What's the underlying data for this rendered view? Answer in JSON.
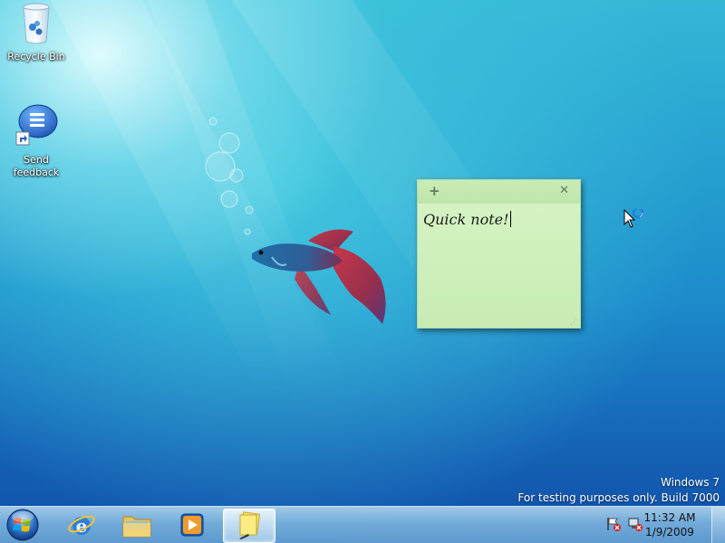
{
  "desktop": {
    "icons": [
      {
        "label": "Recycle Bin"
      },
      {
        "label": "Send feedback"
      }
    ],
    "watermark": {
      "line1": "Windows  7",
      "line2": "For testing purposes only. Build 7000"
    }
  },
  "sticky_note": {
    "text": "Quick note!",
    "add_label": "+",
    "close_label": "✕",
    "color": "#cdeebb"
  },
  "taskbar": {
    "pinned": [
      {
        "name": "Internet Explorer",
        "icon": "ie-icon"
      },
      {
        "name": "Windows Explorer",
        "icon": "folder-icon"
      },
      {
        "name": "Windows Media Player",
        "icon": "media-player-icon"
      },
      {
        "name": "Sticky Notes",
        "icon": "sticky-notes-icon",
        "active": true
      }
    ],
    "tray_icons": [
      "action-center-flag-icon",
      "network-icon"
    ],
    "clock": {
      "time": "11:32 AM",
      "date": "1/9/2009"
    }
  }
}
